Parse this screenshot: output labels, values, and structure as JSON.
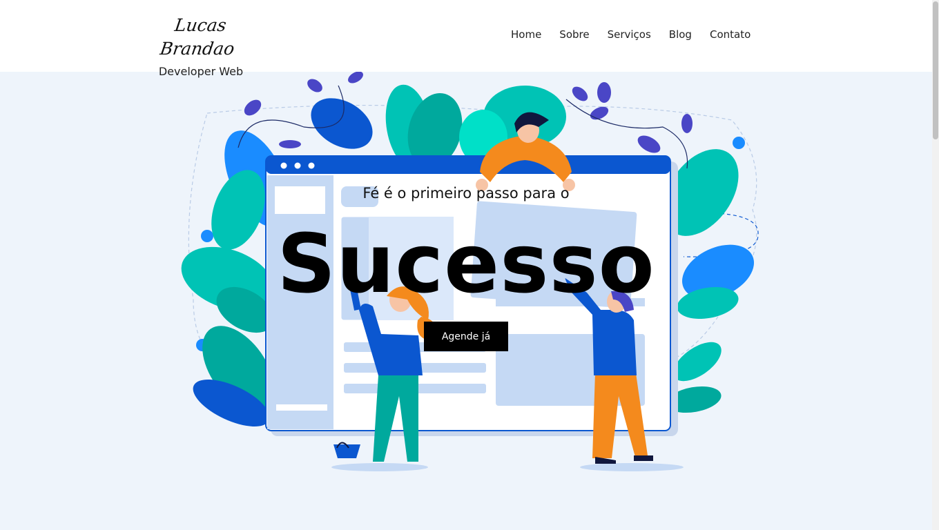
{
  "header": {
    "brand_name": "Lucas Brandao",
    "tagline": "Developer Web",
    "nav": [
      {
        "label": "Home"
      },
      {
        "label": "Sobre"
      },
      {
        "label": "Serviços"
      },
      {
        "label": "Blog"
      },
      {
        "label": "Contato"
      }
    ]
  },
  "hero": {
    "subtitle": "Fé é o primeiro passo para o",
    "title": "Sucesso",
    "cta_label": "Agende já"
  },
  "colors": {
    "page_background": "#eef4fb",
    "header_background": "#ffffff",
    "accent_blue": "#0b57d0",
    "accent_teal": "#00c3b5",
    "accent_orange": "#f48a1d",
    "button_background": "#000000"
  }
}
